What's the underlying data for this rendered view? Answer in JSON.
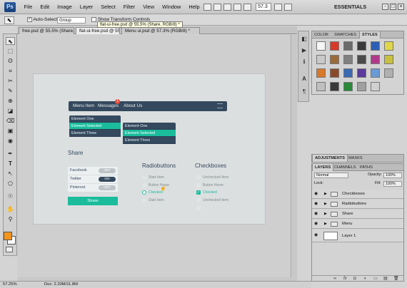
{
  "menubar": {
    "logo": "Ps",
    "items": [
      "File",
      "Edit",
      "Image",
      "Layer",
      "Select",
      "Filter",
      "View",
      "Window",
      "Help"
    ],
    "zoom": "57.3",
    "workspace": "ESSENTIALS",
    "window_buttons": [
      "-",
      "□",
      "×"
    ]
  },
  "options": {
    "auto_select_label": "Auto-Select:",
    "auto_select_value": "Group",
    "show_transform_label": "Show Transform Controls"
  },
  "tabs": [
    "free.psd @ 55.5% (Share, RGB/8) ×",
    "flat-ui-free.psd @ 55.5% (Share, RGB/8) *",
    "Menu ui.psd @ 57.3% (RGB/8) *"
  ],
  "tooltip": "flat-ui-free.psd @ 55.5% (Share, RGB/8) *",
  "tools": [
    "⬉",
    "⬚",
    "ʘ",
    "⌗",
    "✂",
    "✎",
    "⊕",
    "◪",
    "⌫",
    "▣",
    "◉",
    "✒",
    "T",
    "↖",
    "⬠",
    "☉",
    "✋",
    "⚲"
  ],
  "design": {
    "nav": {
      "menu_item": "Menu Item",
      "messages": "Messages",
      "badge": "1",
      "about": "About Us"
    },
    "dropdown1": [
      "Element One",
      "Element Selected",
      "Element Three"
    ],
    "dropdown2": [
      "Element One",
      "Element Selected",
      "Element Three"
    ],
    "share": {
      "title": "Share",
      "rows": [
        {
          "label": "Facebook",
          "state": "OFF",
          "on": false
        },
        {
          "label": "Twitter",
          "state": "ON",
          "on": true
        },
        {
          "label": "Pinterest",
          "state": "OFF",
          "on": false
        }
      ],
      "button": "Share"
    },
    "radio": {
      "title": "Radiobuttons",
      "items": [
        {
          "label": "Start Item",
          "on": false
        },
        {
          "label": "Button Hover",
          "on": false
        },
        {
          "label": "Checked",
          "on": true
        },
        {
          "label": "Start Item",
          "on": false
        }
      ]
    },
    "checkbox": {
      "title": "Checkboxes",
      "items": [
        {
          "label": "Unchecked Item",
          "on": false
        },
        {
          "label": "Button Hover",
          "on": false
        },
        {
          "label": "Checked",
          "on": true
        },
        {
          "label": "Unchecked Item",
          "on": false
        },
        {
          "label": "",
          "on": false
        }
      ]
    }
  },
  "styles_panel": {
    "tabs": [
      "COLOR",
      "SWATCHES",
      "STYLES"
    ],
    "swatch_colors": [
      "#f6f6f6",
      "#d83a2a",
      "#6a6a6a",
      "#3a3a3a",
      "#2b5fb4",
      "#e0d64a",
      "#c9c9c9",
      "#9a6b3a",
      "#808080",
      "#4a4a4a",
      "#b03a8a",
      "#c9c040",
      "#d7782a",
      "#8a4a2a",
      "#3a6ab4",
      "#5a3a9a",
      "#6a9ad4",
      "#b0b0b0",
      "#c0c0c0",
      "#3a3a3a",
      "#2a8a3a",
      "#a0a0a0",
      "#d0d0d0"
    ]
  },
  "adjust_panel": {
    "tabs": [
      "ADJUSTMENTS",
      "MASKS"
    ]
  },
  "layers_panel": {
    "tabs": [
      "LAYERS",
      "CHANNELS",
      "PATHS"
    ],
    "blend_mode": "Normal",
    "opacity_label": "Opacity:",
    "opacity": "100%",
    "lock_label": "Lock:",
    "fill_label": "Fill:",
    "fill": "100%",
    "layers": [
      {
        "name": "Checkboxes",
        "type": "folder"
      },
      {
        "name": "Radiobuttons",
        "type": "folder"
      },
      {
        "name": "Share",
        "type": "folder"
      },
      {
        "name": "Menu",
        "type": "folder"
      },
      {
        "name": "Layer 1",
        "type": "layer"
      }
    ],
    "footer_icons": [
      "link",
      "fx",
      "mask",
      "adjust",
      "group",
      "new",
      "trash"
    ]
  },
  "status": {
    "zoom": "57.25%",
    "doc": "Doc: 2.20M/11.8M"
  }
}
